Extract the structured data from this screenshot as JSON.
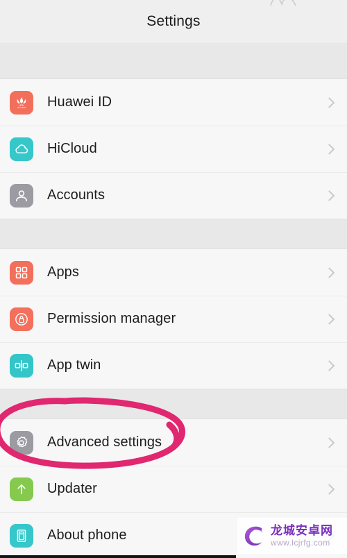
{
  "header": {
    "title": "Settings"
  },
  "colors": {
    "huawei_red": "#f2705b",
    "hicloud_teal": "#35c7c9",
    "accounts_gray": "#9b9ba1",
    "apps_orange": "#f2705b",
    "permission_orange": "#f4705c",
    "app_twin_teal": "#33c6c8",
    "advanced_gray": "#9b9ba1",
    "updater_green": "#85ca4f",
    "about_cyan": "#35c7c9",
    "annotation_pink": "#e0276f",
    "chevron_gray": "#c9c9c9",
    "page_background": "#f7f7f7",
    "section_gap": "#e8e8e8"
  },
  "sections": [
    {
      "id": "account-section",
      "rows": [
        {
          "id": "huawei-id",
          "label": "Huawei ID",
          "icon": "huawei-logo-icon",
          "chevron": "chevron-right-icon"
        },
        {
          "id": "hicloud",
          "label": "HiCloud",
          "icon": "cloud-icon",
          "chevron": "chevron-right-icon"
        },
        {
          "id": "accounts",
          "label": "Accounts",
          "icon": "person-icon",
          "chevron": "chevron-right-icon"
        }
      ]
    },
    {
      "id": "apps-section",
      "rows": [
        {
          "id": "apps",
          "label": "Apps",
          "icon": "grid-apps-icon",
          "chevron": "chevron-right-icon"
        },
        {
          "id": "permission-manager",
          "label": "Permission manager",
          "icon": "lock-circle-icon",
          "chevron": "chevron-right-icon"
        },
        {
          "id": "app-twin",
          "label": "App twin",
          "icon": "app-twin-icon",
          "chevron": "chevron-right-icon"
        }
      ]
    },
    {
      "id": "system-section",
      "rows": [
        {
          "id": "advanced-settings",
          "label": "Advanced settings",
          "icon": "gear-icon",
          "chevron": "chevron-right-icon",
          "highlighted": true
        },
        {
          "id": "updater",
          "label": "Updater",
          "icon": "arrow-up-icon",
          "chevron": "chevron-right-icon"
        },
        {
          "id": "about-phone",
          "label": "About phone",
          "icon": "phone-info-icon",
          "chevron": "chevron-right-icon"
        }
      ]
    }
  ],
  "annotation": {
    "name": "advanced-settings-highlight-circle",
    "shape": "hand-drawn-ellipse",
    "color": "#e0276f",
    "targets": "Advanced settings"
  },
  "watermark": {
    "site_name": "龙城安卓网",
    "url": "www.lcjrfg.com"
  }
}
